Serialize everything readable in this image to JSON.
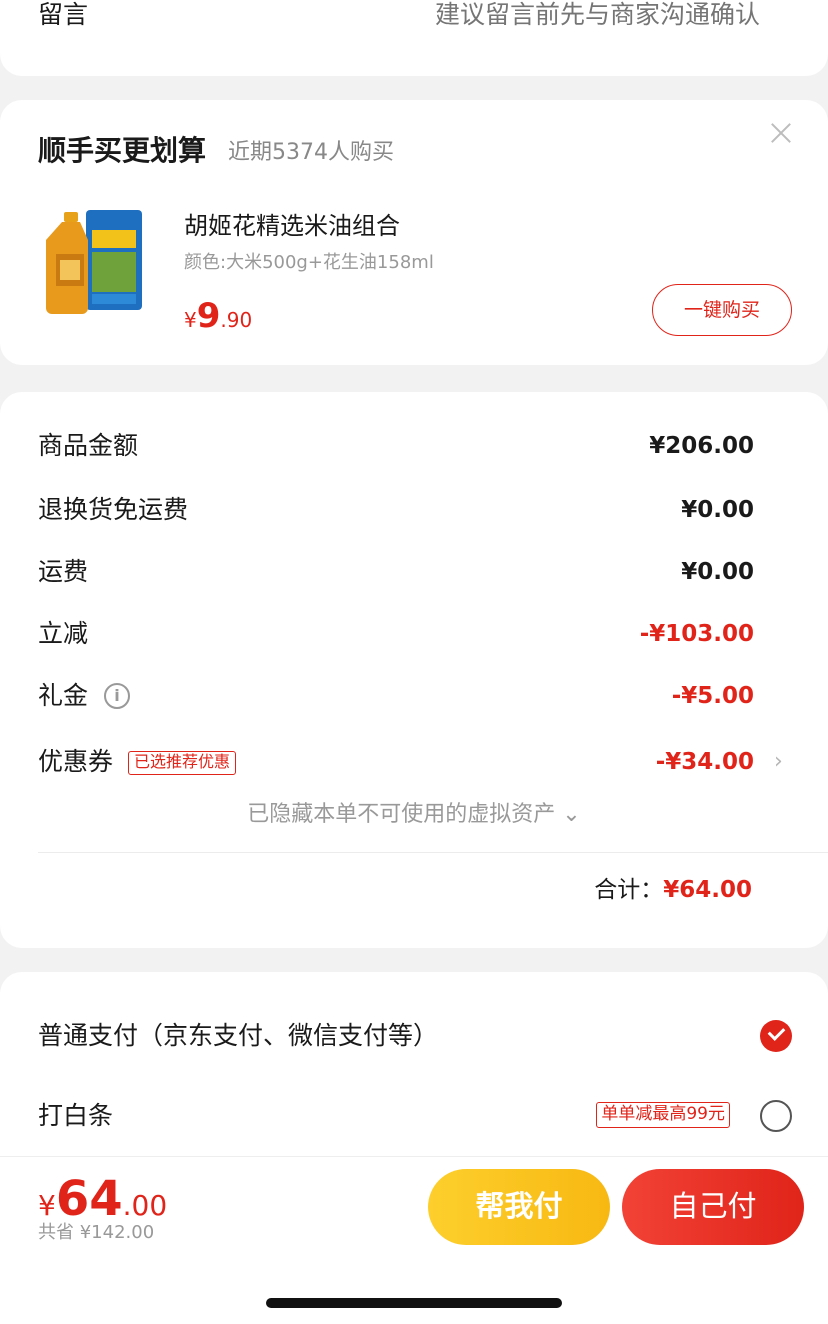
{
  "note": {
    "label": "留言",
    "placeholder": "建议留言前先与商家沟通确认"
  },
  "upsell": {
    "title": "顺手买更划算",
    "subtitle": "近期5374人购买",
    "product_name": "胡姬花精选米油组合",
    "product_spec": "颜色:大米500g+花生油158ml",
    "price_currency": "¥",
    "price_int": "9",
    "price_dec": ".90",
    "buy_label": "一键购买"
  },
  "summary": {
    "rows": [
      {
        "label": "商品金额",
        "value": "¥206.00"
      },
      {
        "label": "退换货免运费",
        "value": "¥0.00"
      },
      {
        "label": "运费",
        "value": "¥0.00"
      },
      {
        "label": "立减",
        "value": "-¥103.00"
      },
      {
        "label": "礼金",
        "value": "-¥5.00"
      },
      {
        "label": "优惠券",
        "value": "-¥34.00",
        "tag": "已选推荐优惠"
      }
    ],
    "hidden_assets": "已隐藏本单不可使用的虚拟资产",
    "total_label": "合计：",
    "total_value": "¥64.00"
  },
  "payment": {
    "options": [
      {
        "label": "普通支付（京东支付、微信支付等）",
        "selected": true
      },
      {
        "label": "打白条",
        "promo": "单单减最高99元",
        "selected": false
      }
    ]
  },
  "bottom": {
    "currency": "¥",
    "price_int": "64",
    "price_dec": ".00",
    "saved": "共省 ¥142.00",
    "help_pay": "帮我付",
    "self_pay": "自己付"
  },
  "colors": {
    "accent": "#e0241a",
    "help_button": "#fbc21f",
    "background": "#f2f2f2"
  }
}
